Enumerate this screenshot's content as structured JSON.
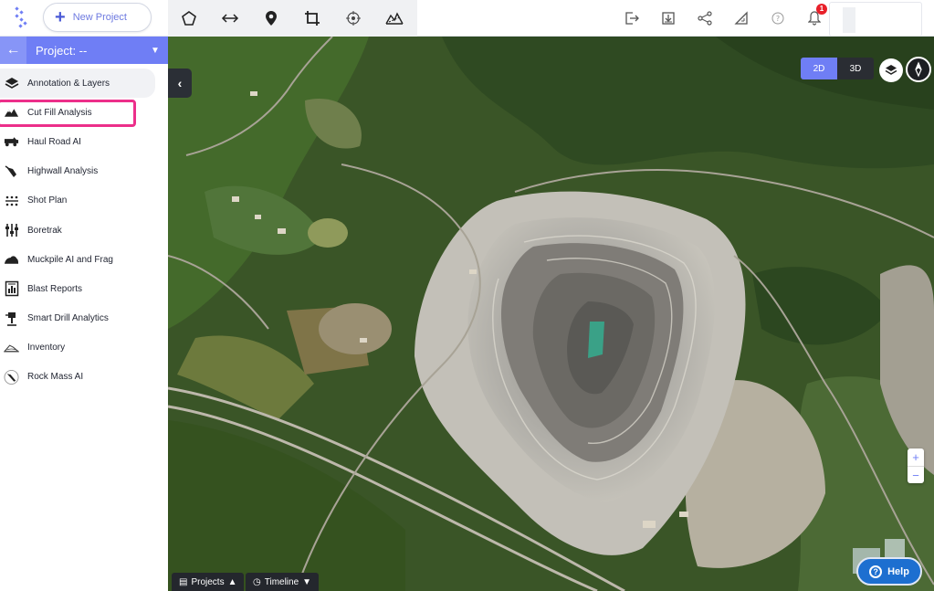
{
  "topbar": {
    "logo_icon": "app-logo-icon",
    "new_project_label": "New Project",
    "tools": [
      "polygon-icon",
      "measure-distance-icon",
      "location-pin-icon",
      "crop-icon",
      "target-icon",
      "elevation-profile-icon"
    ],
    "right_icons": [
      "export-icon",
      "download-icon",
      "share-icon",
      "ruler-triangle-icon",
      "help-circle-icon",
      "bell-icon"
    ],
    "notification_count": "1"
  },
  "sidebar": {
    "project_title": "Project: --",
    "items": [
      {
        "label": "Annotation & Layers",
        "icon": "layers-icon"
      },
      {
        "label": "Cut Fill Analysis",
        "icon": "mountain-icon"
      },
      {
        "label": "Haul Road AI",
        "icon": "truck-icon"
      },
      {
        "label": "Highwall Analysis",
        "icon": "highwall-icon"
      },
      {
        "label": "Shot Plan",
        "icon": "shot-plan-icon"
      },
      {
        "label": "Boretrak",
        "icon": "boretrak-icon"
      },
      {
        "label": "Muckpile AI and Frag",
        "icon": "muckpile-icon"
      },
      {
        "label": "Blast Reports",
        "icon": "report-icon"
      },
      {
        "label": "Smart Drill Analytics",
        "icon": "drill-icon"
      },
      {
        "label": "Inventory",
        "icon": "stockpile-icon"
      },
      {
        "label": "Rock Mass AI",
        "icon": "rock-mass-icon"
      }
    ],
    "selected_item": "Cut Fill Analysis"
  },
  "map": {
    "view_2d": "2D",
    "view_3d": "3D",
    "active_view": "2D",
    "zoom_in": "+",
    "zoom_out": "−",
    "help_label": "Help",
    "tab_projects": "Projects",
    "tab_timeline": "Timeline"
  },
  "colors": {
    "accent": "#6f7ef5",
    "highlight": "#ec2f8a",
    "help": "#1d6fd0",
    "badge": "#e8202a"
  }
}
